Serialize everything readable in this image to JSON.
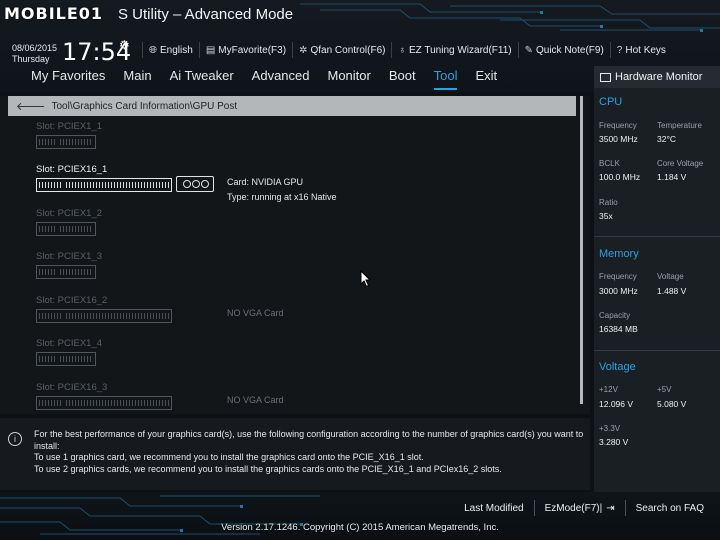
{
  "app": {
    "logo_text": "MOBILE01",
    "title": "S Utility – Advanced Mode"
  },
  "clock": {
    "date": "08/06/2015",
    "day": "Thursday",
    "time": "17:54"
  },
  "tools": [
    {
      "icon": "globe-icon",
      "label": "English"
    },
    {
      "icon": "favorite-icon",
      "label": "MyFavorite(F3)"
    },
    {
      "icon": "fan-icon",
      "label": "Qfan Control(F6)"
    },
    {
      "icon": "wizard-icon",
      "label": "EZ Tuning Wizard(F11)"
    },
    {
      "icon": "note-icon",
      "label": "Quick Note(F9)"
    },
    {
      "icon": "question-icon",
      "label": "Hot Keys"
    }
  ],
  "nav": [
    {
      "label": "My Favorites",
      "active": false
    },
    {
      "label": "Main",
      "active": false
    },
    {
      "label": "Ai Tweaker",
      "active": false
    },
    {
      "label": "Advanced",
      "active": false
    },
    {
      "label": "Monitor",
      "active": false
    },
    {
      "label": "Boot",
      "active": false
    },
    {
      "label": "Tool",
      "active": true
    },
    {
      "label": "Exit",
      "active": false
    }
  ],
  "breadcrumb": "Tool\\Graphics Card Information\\GPU Post",
  "slots": [
    {
      "label": "Slot: PCIEX1_1",
      "type": "x1",
      "active": false,
      "status": ""
    },
    {
      "label": "Slot: PCIEX16_1",
      "type": "x16",
      "active": true,
      "status": ""
    },
    {
      "label": "Slot: PCIEX1_2",
      "type": "x1",
      "active": false,
      "status": ""
    },
    {
      "label": "Slot: PCIEX1_3",
      "type": "x1",
      "active": false,
      "status": ""
    },
    {
      "label": "Slot: PCIEX16_2",
      "type": "x16",
      "active": false,
      "status": "NO VGA Card"
    },
    {
      "label": "Slot: PCIEX1_4",
      "type": "x1",
      "active": false,
      "status": ""
    },
    {
      "label": "Slot: PCIEX16_3",
      "type": "x16",
      "active": false,
      "status": "NO VGA Card"
    }
  ],
  "card_info": {
    "card": "Card: NVIDIA GPU",
    "type": "Type: running at x16 Native"
  },
  "info": {
    "line1": "For the best performance of your graphics card(s), use the following configuration according to the number of graphics card(s) you want to install:",
    "line2": "To use 1 graphics card, we recommend you to install  the graphics card onto the PCIE_X16_1 slot.",
    "line3": "To use 2 graphics cards, we recommend you to install the graphics cards onto the PCIE_X16_1 and PCIex16_2 slots."
  },
  "hw_monitor": {
    "title": "Hardware Monitor",
    "cpu": {
      "title": "CPU",
      "frequency_label": "Frequency",
      "frequency": "3500 MHz",
      "temperature_label": "Temperature",
      "temperature": "32°C",
      "bclk_label": "BCLK",
      "bclk": "100.0 MHz",
      "core_voltage_label": "Core Voltage",
      "core_voltage": "1.184 V",
      "ratio_label": "Ratio",
      "ratio": "35x"
    },
    "memory": {
      "title": "Memory",
      "frequency_label": "Frequency",
      "frequency": "3000 MHz",
      "voltage_label": "Voltage",
      "voltage": "1.488 V",
      "capacity_label": "Capacity",
      "capacity": "16384 MB"
    },
    "voltage": {
      "title": "Voltage",
      "v12_label": "+12V",
      "v12": "12.096 V",
      "v5_label": "+5V",
      "v5": "5.080 V",
      "v33_label": "+3.3V",
      "v33": "3.280 V"
    }
  },
  "footer": {
    "last_modified": "Last Modified",
    "ez_mode": "EzMode(F7)|",
    "search_faq": "Search on FAQ",
    "version": "Version 2.17.1246. Copyright (C) 2015 American Megatrends, Inc."
  },
  "colors": {
    "accent": "#2ba1e6",
    "background": "#0d1116"
  }
}
